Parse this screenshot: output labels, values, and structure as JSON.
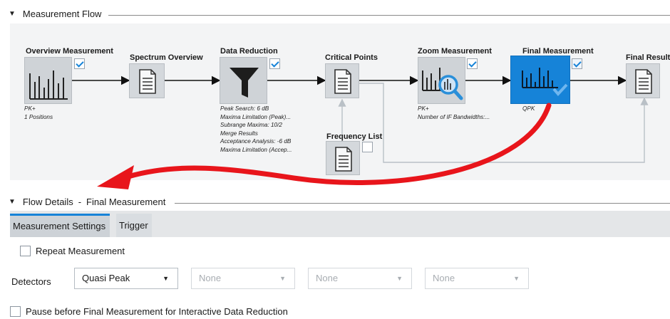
{
  "measurement_flow": {
    "title": "Measurement Flow",
    "nodes": {
      "overview": {
        "label": "Overview Measurement",
        "checked": true,
        "info": [
          "PK+",
          "1 Positions"
        ]
      },
      "spectrum": {
        "label": "Spectrum Overview"
      },
      "reduction": {
        "label": "Data Reduction",
        "checked": true,
        "info": [
          "Peak Search: 6 dB",
          "Maxima Limitation (Peak)...",
          "Subrange Maxima: 10/2",
          "Merge Results",
          "Acceptance Analysis: -6 dB",
          "Maxima Limitation (Accep..."
        ]
      },
      "critical": {
        "label": "Critical Points"
      },
      "zoom": {
        "label": "Zoom Measurement",
        "checked": true,
        "info": [
          "PK+",
          "Number of IF Bandwidths:..."
        ]
      },
      "final": {
        "label": "Final Measurement",
        "checked": true,
        "info": [
          "QPK"
        ]
      },
      "results": {
        "label": "Final Results"
      },
      "frequency": {
        "label": "Frequency List",
        "checked": false
      }
    }
  },
  "flow_details": {
    "title": "Flow Details",
    "separator": "-",
    "subtitle": "Final Measurement"
  },
  "tabs": [
    "Measurement Settings",
    "Trigger"
  ],
  "settings": {
    "repeat_label": "Repeat Measurement",
    "detectors_label": "Detectors",
    "detectors": [
      "Quasi Peak",
      "None",
      "None",
      "None"
    ],
    "pause_label": "Pause before Final Measurement for Interactive Data Reduction"
  },
  "colors": {
    "accent": "#1683d8",
    "annotation_arrow": "#e8151b"
  }
}
